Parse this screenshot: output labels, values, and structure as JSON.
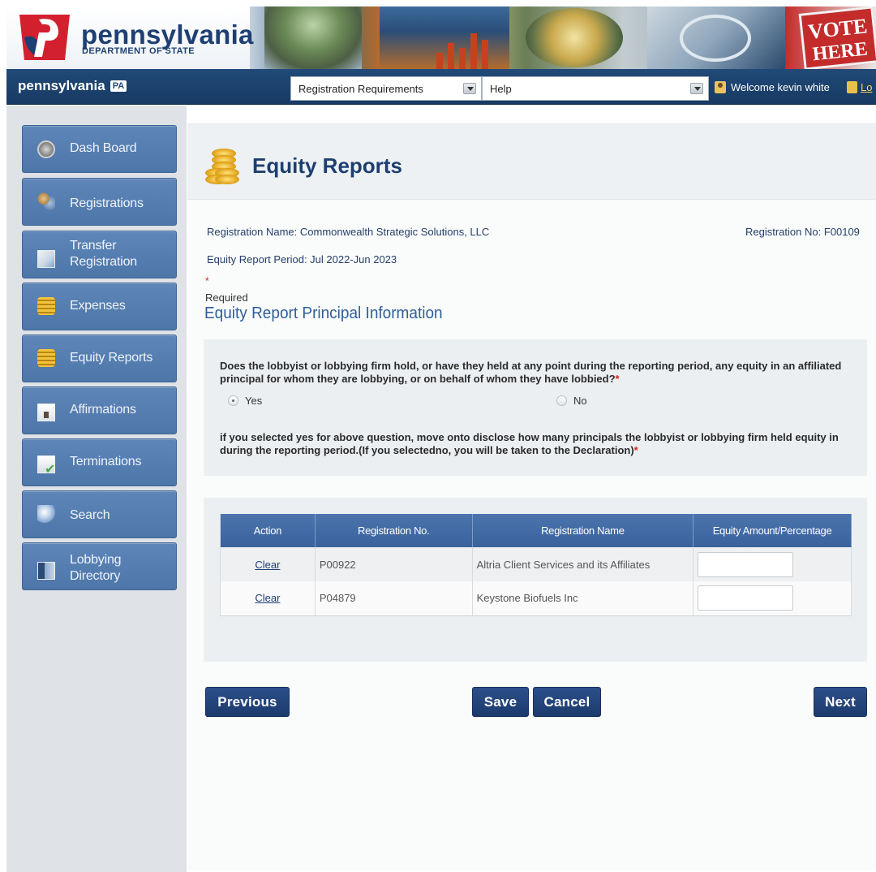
{
  "header": {
    "logo_title": "pennsylvania",
    "logo_subtitle": "DEPARTMENT OF STATE",
    "vote_line1": "VOTE",
    "vote_line2": "HERE"
  },
  "navbar": {
    "brand": "pennsylvania",
    "brand_badge": "PA",
    "registration_select": "Registration Requirements",
    "help_select": "Help",
    "welcome": "Welcome kevin white",
    "logout": "Lo"
  },
  "sidebar": {
    "items": [
      {
        "label": "Dash Board",
        "icon": "dashboard-icon"
      },
      {
        "label": "Registrations",
        "icon": "registrations-icon"
      },
      {
        "label_line1": "Transfer",
        "label_line2": "Registration",
        "icon": "transfer-icon"
      },
      {
        "label": "Expenses",
        "icon": "coins-icon"
      },
      {
        "label": "Equity Reports",
        "icon": "coins-icon"
      },
      {
        "label": "Affirmations",
        "icon": "document-icon"
      },
      {
        "label": "Terminations",
        "icon": "check-document-icon"
      },
      {
        "label": "Search",
        "icon": "search-icon"
      },
      {
        "label_line1": "Lobbying",
        "label_line2": "Directory",
        "icon": "book-icon"
      }
    ]
  },
  "main": {
    "title": "Equity Reports",
    "registration_name": "Registration Name: Commonwealth Strategic Solutions, LLC",
    "registration_no": "Registration No: F00109",
    "report_period": "Equity Report Period: Jul 2022-Jun 2023",
    "required_star": "*",
    "required_text": "Required",
    "section_title": "Equity Report Principal Information",
    "question1": "Does the lobbyist or lobbying firm hold, or have they held at any point during the reporting period, any equity in an affiliated principal for whom they are lobbying, or on behalf of whom they have lobbied?",
    "question2": "if you selected yes for above question, move onto disclose how many principals the lobbyist or lobbying firm held equity in during the reporting period.(If you selectedno, you will be taken to the Declaration)",
    "star": "*",
    "radio_yes": "Yes",
    "radio_no": "No",
    "selected": "Yes",
    "table": {
      "headers": [
        "Action",
        "Registration No.",
        "Registration Name",
        "Equity Amount/Percentage"
      ],
      "rows": [
        {
          "action": "Clear",
          "reg_no": "P00922",
          "reg_name": "Altria Client Services and its Affiliates",
          "amount": ""
        },
        {
          "action": "Clear",
          "reg_no": "P04879",
          "reg_name": "Keystone Biofuels Inc",
          "amount": ""
        }
      ]
    },
    "buttons": {
      "previous": "Previous",
      "save": "Save",
      "cancel": "Cancel",
      "next": "Next"
    }
  },
  "colors": {
    "nav_blue": "#1b416c",
    "sidebar_button": "#5580b3",
    "title_blue": "#1d3f6f",
    "button_navy": "#24457b",
    "required_red": "#dd2222"
  }
}
